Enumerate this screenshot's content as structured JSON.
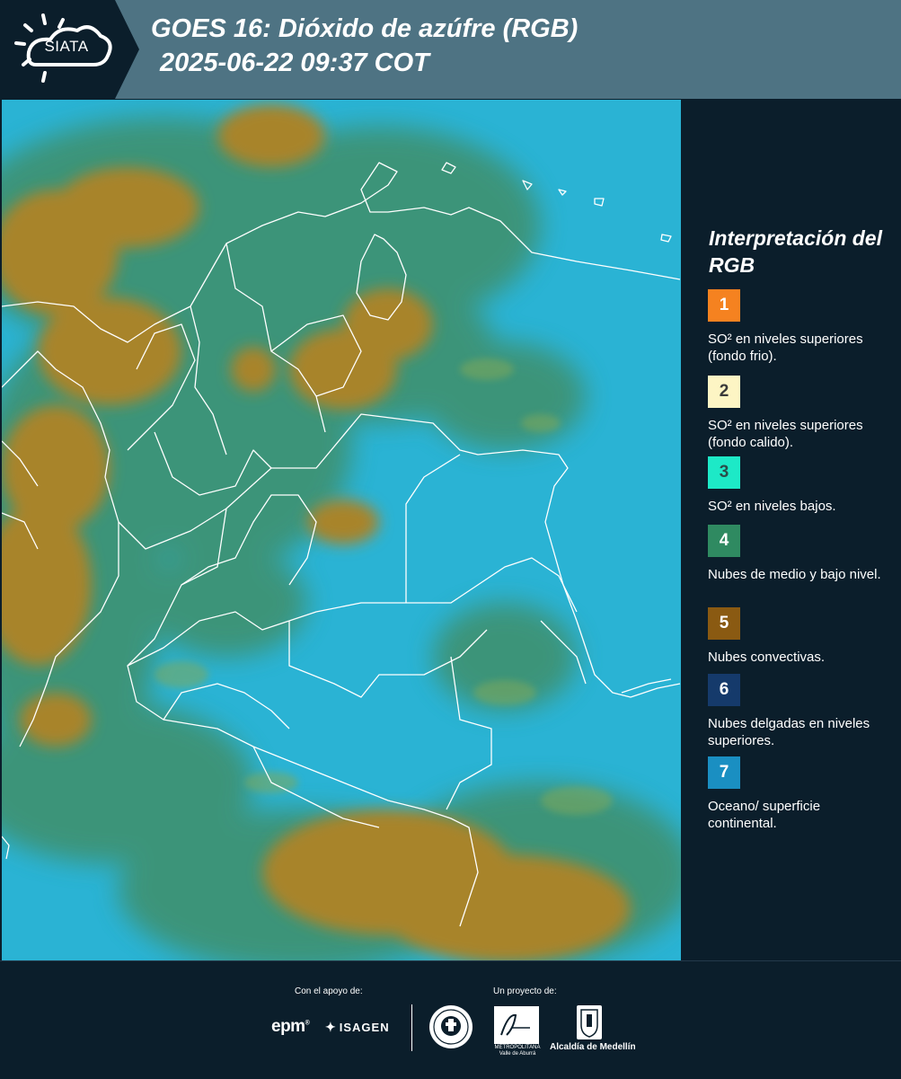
{
  "header": {
    "logo_text": "SIATA",
    "title_line1": "GOES 16: Dióxido de azúfre (RGB)",
    "title_line2": "2025-06-22 09:37 COT",
    "background": "#4e7383"
  },
  "map": {
    "description_colors": {
      "ocean_surface": "#2ab3d4",
      "low_mid_clouds": "#3f8f6a",
      "convective": "#a8842c",
      "borders": "#ffffff"
    }
  },
  "legend": {
    "title": "Interpretación del RGB",
    "items": [
      {
        "number": "1",
        "color": "#f58220",
        "number_color": "#ffffff",
        "text": "SO² en niveles superiores (fondo frio)."
      },
      {
        "number": "2",
        "color": "#fdf5c4",
        "number_color": "#3a3a3a",
        "text": "SO² en niveles superiores (fondo calido)."
      },
      {
        "number": "3",
        "color": "#1de9c7",
        "number_color": "#2b4d4a",
        "text": "SO² en niveles bajos."
      },
      {
        "number": "4",
        "color": "#2f8a61",
        "number_color": "#ffffff",
        "text": "Nubes de medio y bajo nivel."
      },
      {
        "number": "5",
        "color": "#8a5a12",
        "number_color": "#ffffff",
        "text": "Nubes convectivas."
      },
      {
        "number": "6",
        "color": "#153a6b",
        "number_color": "#ffffff",
        "text": "Nubes delgadas en niveles superiores."
      },
      {
        "number": "7",
        "color": "#1a8fc2",
        "number_color": "#ffffff",
        "text": "Oceano/ superficie continental."
      }
    ]
  },
  "footer": {
    "support_label": "Con el apoyo de:",
    "project_label": "Un proyecto de:",
    "sponsor_epm": "epm",
    "sponsor_isagen": "ISAGEN",
    "area_text": "METROPOLITANA Valle de Aburrá",
    "area_word": "Área",
    "alcaldia_text": "Alcaldía de Medellín"
  }
}
